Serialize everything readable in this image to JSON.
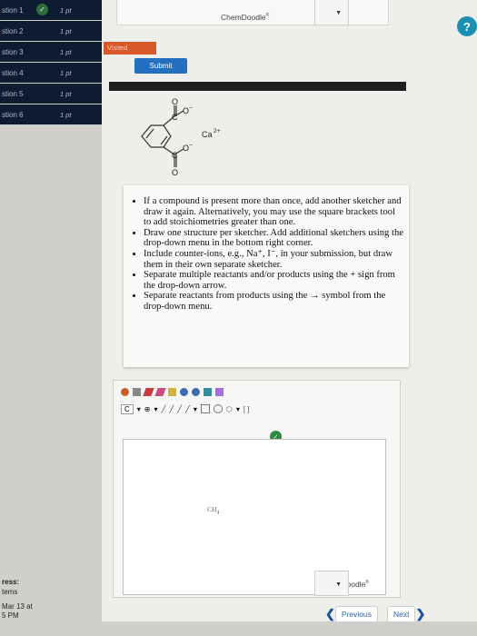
{
  "sidebar": {
    "questions": [
      {
        "name": "stion 1",
        "points": "1 pt",
        "checked": true
      },
      {
        "name": "stion 2",
        "points": "1 pt",
        "checked": false
      },
      {
        "name": "stion 3",
        "points": "1 pt",
        "checked": false
      },
      {
        "name": "stion 4",
        "points": "1 pt",
        "checked": false
      },
      {
        "name": "stion 5",
        "points": "1 pt",
        "checked": false
      },
      {
        "name": "stion 6",
        "points": "1 pt",
        "checked": false
      }
    ],
    "progress_label": "ress:",
    "items_label": "tems",
    "date": "Mar 13 at",
    "time": "5 PM"
  },
  "header": {
    "brand": "ChemDoodle",
    "brand_mark": "®",
    "help_icon": "?"
  },
  "visited_label": "Visited",
  "submit_label": "Submit",
  "structure": {
    "atoms": [
      "O",
      "C",
      "O",
      "O",
      "C",
      "O"
    ],
    "charge_o1": "−",
    "charge_o2": "−",
    "cation": "Ca",
    "cation_charge": "2+"
  },
  "instructions": [
    "If a compound is present more than once, add another sketcher and draw it again. Alternatively, you may use the square brackets tool to add stoichiometries greater than one.",
    "Draw one structure per sketcher. Add additional sketchers using the drop-down menu in the bottom right corner.",
    "Include counter-ions, e.g., Na⁺, I⁻, in your submission, but draw them in their own separate sketcher.",
    "Separate multiple reactants and/or products using the + sign from the drop-down arrow.",
    "Separate reactants from products using the → symbol from the drop-down menu."
  ],
  "sketcher": {
    "atom_selector": "C",
    "canvas_label": "CH",
    "canvas_label_sub": "4",
    "brand": "ChemDoodle",
    "brand_mark": "®"
  },
  "nav": {
    "previous": "Previous",
    "next": "Next"
  },
  "colors": {
    "sidebar_item": "#0d1c30",
    "visited": "#d9582a",
    "submit": "#2270bf",
    "help": "#1d8fb5",
    "check": "#2f6d3c"
  }
}
